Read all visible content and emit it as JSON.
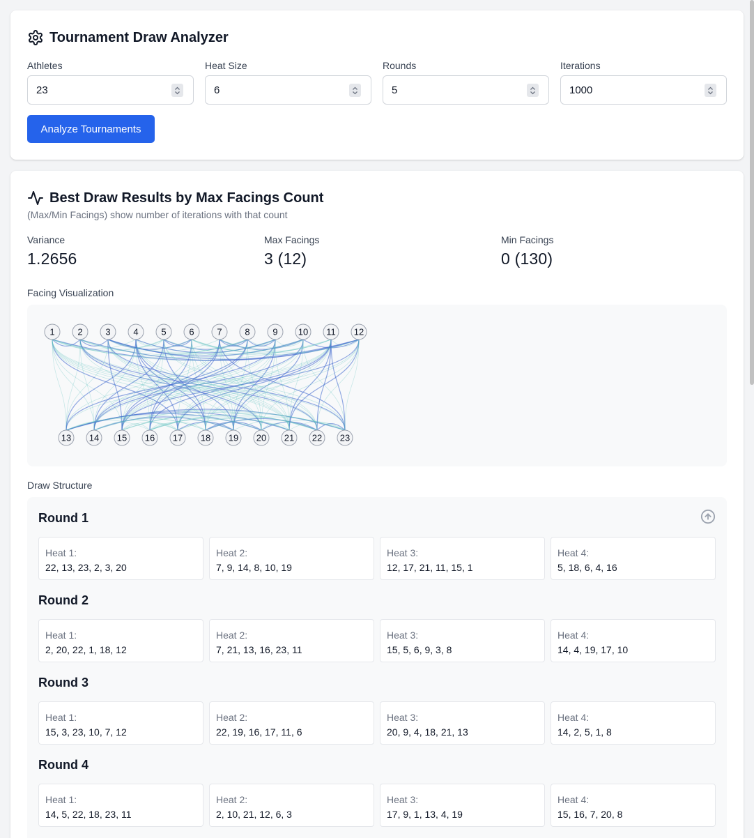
{
  "config": {
    "title": "Tournament Draw Analyzer",
    "icon": "gear-icon",
    "fields": [
      {
        "label": "Athletes",
        "value": "23"
      },
      {
        "label": "Heat Size",
        "value": "6"
      },
      {
        "label": "Rounds",
        "value": "5"
      },
      {
        "label": "Iterations",
        "value": "1000"
      }
    ],
    "analyze_label": "Analyze Tournaments"
  },
  "results": {
    "title": "Best Draw Results by Max Facings Count",
    "icon": "activity-icon",
    "subtitle": "(Max/Min Facings) show number of iterations with that count",
    "stats": [
      {
        "label": "Variance",
        "value": "1.2656"
      },
      {
        "label": "Max Facings",
        "value": "3 (12)"
      },
      {
        "label": "Min Facings",
        "value": "0 (130)"
      }
    ],
    "viz_label": "Facing Visualization",
    "draw_label": "Draw Structure",
    "top_nodes": [
      "1",
      "2",
      "3",
      "4",
      "5",
      "6",
      "7",
      "8",
      "9",
      "10",
      "11",
      "12"
    ],
    "bottom_nodes": [
      "13",
      "14",
      "15",
      "16",
      "17",
      "18",
      "19",
      "20",
      "21",
      "22",
      "23"
    ],
    "rounds": [
      {
        "title": "Round 1",
        "heats": [
          {
            "name": "Heat 1:",
            "athletes": "22, 13, 23, 2, 3, 20"
          },
          {
            "name": "Heat 2:",
            "athletes": "7, 9, 14, 8, 10, 19"
          },
          {
            "name": "Heat 3:",
            "athletes": "12, 17, 21, 11, 15, 1"
          },
          {
            "name": "Heat 4:",
            "athletes": "5, 18, 6, 4, 16"
          }
        ]
      },
      {
        "title": "Round 2",
        "heats": [
          {
            "name": "Heat 1:",
            "athletes": "2, 20, 22, 1, 18, 12"
          },
          {
            "name": "Heat 2:",
            "athletes": "7, 21, 13, 16, 23, 11"
          },
          {
            "name": "Heat 3:",
            "athletes": "15, 5, 6, 9, 3, 8"
          },
          {
            "name": "Heat 4:",
            "athletes": "14, 4, 19, 17, 10"
          }
        ]
      },
      {
        "title": "Round 3",
        "heats": [
          {
            "name": "Heat 1:",
            "athletes": "15, 3, 23, 10, 7, 12"
          },
          {
            "name": "Heat 2:",
            "athletes": "22, 19, 16, 17, 11, 6"
          },
          {
            "name": "Heat 3:",
            "athletes": "20, 9, 4, 18, 21, 13"
          },
          {
            "name": "Heat 4:",
            "athletes": "14, 2, 5, 1, 8"
          }
        ]
      },
      {
        "title": "Round 4",
        "heats": [
          {
            "name": "Heat 1:",
            "athletes": "14, 5, 22, 18, 23, 11"
          },
          {
            "name": "Heat 2:",
            "athletes": "2, 10, 21, 12, 6, 3"
          },
          {
            "name": "Heat 3:",
            "athletes": "17, 9, 1, 13, 4, 19"
          },
          {
            "name": "Heat 4:",
            "athletes": "15, 16, 7, 20, 8"
          }
        ]
      }
    ],
    "scroll_top_icon": "arrow-up-circle-icon"
  },
  "colors": {
    "accent": "#2563eb",
    "edge_light": "#5bc0be",
    "edge_strong": "#4a6fd1"
  }
}
